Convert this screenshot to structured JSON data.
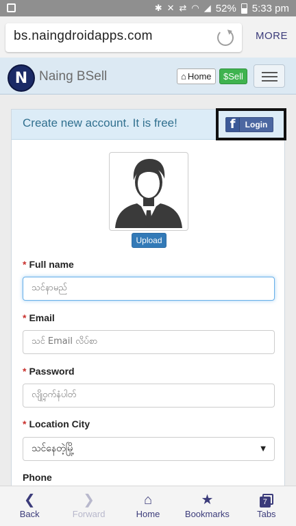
{
  "status_bar": {
    "battery": "52%",
    "time": "5:33 pm"
  },
  "browser": {
    "url": "bs.naingdroidapps.com",
    "more_label": "MORE"
  },
  "navbar": {
    "logo_letter": "N",
    "brand": "Naing BSell",
    "home_label": "Home",
    "sell_label": "$Sell"
  },
  "panel": {
    "title": "Create new account. It is free!",
    "fb_icon_letter": "f",
    "fb_login_label": "Login",
    "upload_label": "Upload"
  },
  "form": {
    "required_mark": "*",
    "fullname_label": "Full name",
    "fullname_placeholder": "သင်နာမည်",
    "email_label": "Email",
    "email_placeholder": "သင် Email လိပ်စာ",
    "password_label": "Password",
    "password_placeholder": "လျို့ဝှက်နံပါတ်",
    "city_label": "Location City",
    "city_value": "သင်နေတဲ့မြို့",
    "phone_label": "Phone"
  },
  "bottom_bar": {
    "back": "Back",
    "forward": "Forward",
    "home": "Home",
    "bookmarks": "Bookmarks",
    "tabs": "Tabs",
    "tabs_count": "7"
  },
  "colors": {
    "accent": "#3b3b7a",
    "navbar_bg": "#dce9f3",
    "sell_green": "#3fb34f",
    "upload_blue": "#337ab7",
    "required_red": "#c9302c"
  }
}
